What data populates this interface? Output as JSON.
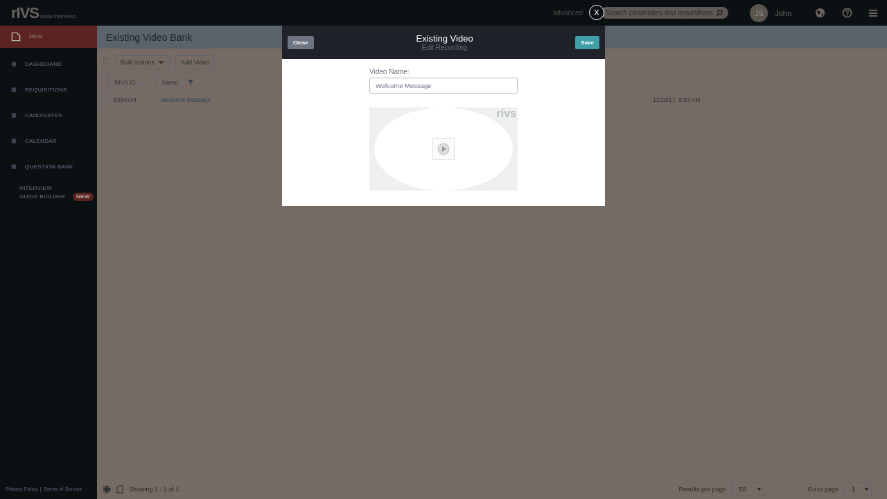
{
  "topbar": {
    "logo": "rIVS",
    "logo_tagline": "digital interviews",
    "advanced_link": "advanced",
    "search": {
      "placeholder": "Search candidates and requisitions"
    },
    "avatar_initials": "JS",
    "user_name": "John"
  },
  "sidebar": {
    "items": [
      {
        "label": "NEW",
        "selected": true
      },
      {
        "label": "DASHBOARD",
        "selected": false
      },
      {
        "label": "REQUISITIONS",
        "selected": false
      },
      {
        "label": "CANDIDATES",
        "selected": false
      },
      {
        "label": "CALENDAR",
        "selected": false
      },
      {
        "label": "QUESTION BANK",
        "selected": false
      },
      {
        "label": "INTERVIEW GUIDE BUILDER",
        "selected": false,
        "badge": "NEW"
      }
    ],
    "footer_links": [
      "Privacy Policy",
      "Terms of Service"
    ],
    "footer_separator": "|"
  },
  "page_title": "Existing Video Bank",
  "toolbar": {
    "bulk_actions": "Bulk Actions",
    "add_video": "Add Video"
  },
  "table": {
    "select_all_checked": false,
    "columns": [
      "RIVS ID",
      "Name"
    ],
    "rows": [
      {
        "checked": false,
        "id": "6384244",
        "name": "Welcome Message",
        "date": "11/28/17, 8:53 AM"
      }
    ]
  },
  "footer": {
    "showing": "Showing 1 - 1 of 1",
    "per_page_label": "Results per page",
    "per_page": "50",
    "goto_label": "Go to page",
    "page": "1"
  },
  "modal": {
    "close_x": "X",
    "title": "Existing Video",
    "subtitle": "Edit Recording",
    "close_button": "Close",
    "save_button": "Save",
    "field_label": "Video Name:",
    "field_value": "Welcome Message",
    "video_logo": "rivs"
  }
}
